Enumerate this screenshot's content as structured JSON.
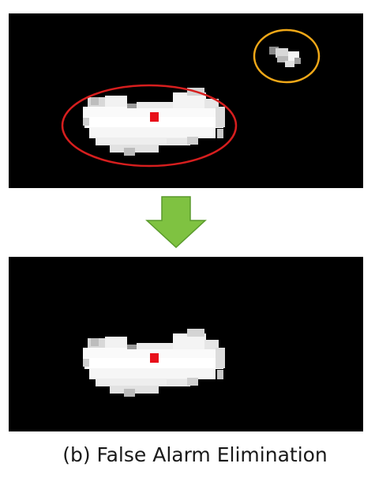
{
  "figure": {
    "caption": "(b) False Alarm Elimination"
  },
  "colors": {
    "background": "#000000",
    "target_marker": "#e8101a",
    "true_target_ellipse": "#d61e1e",
    "false_alarm_ellipse": "#f0a818",
    "arrow_fill": "#7fc241",
    "arrow_stroke": "#5a9a2c"
  },
  "panels": [
    {
      "name": "before-elimination",
      "regions": [
        "true-target-blob",
        "false-alarm-blob"
      ],
      "annotations": [
        "true-target-ellipse",
        "false-alarm-ellipse"
      ]
    },
    {
      "name": "after-elimination",
      "regions": [
        "true-target-blob"
      ],
      "annotations": []
    }
  ],
  "arrow_icon": "down-arrow-icon"
}
